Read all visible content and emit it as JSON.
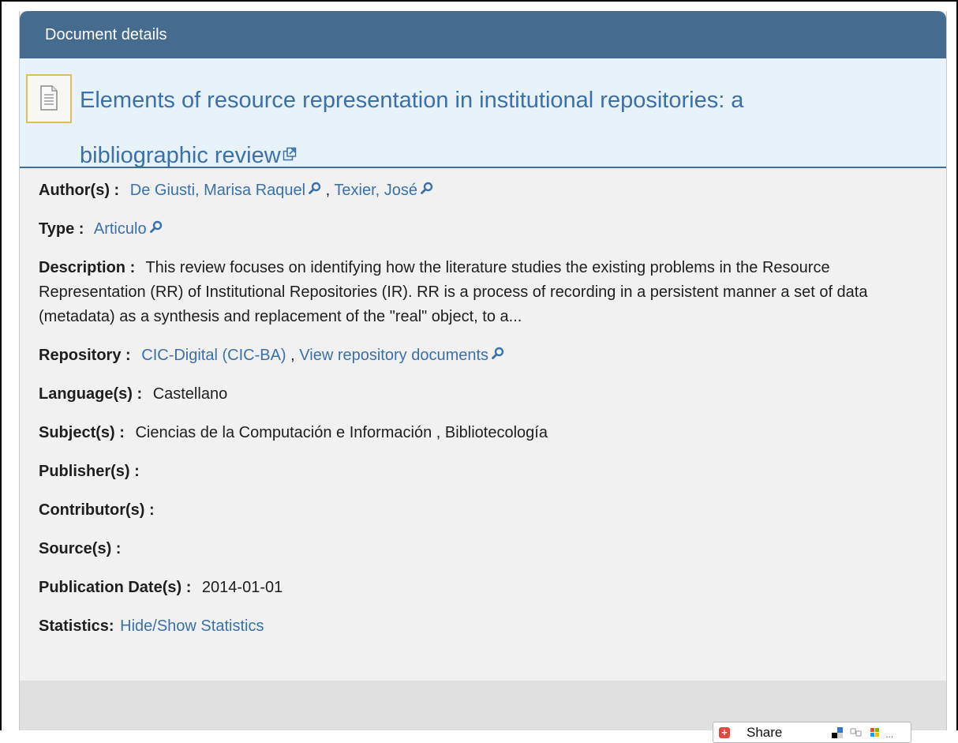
{
  "panel": {
    "header_title": "Document details"
  },
  "document": {
    "title_line1": "Elements of resource representation in institutional repositories: a",
    "title_line2": "bibliographic review"
  },
  "fields": {
    "authors": {
      "label": "Author(s) :",
      "values": [
        "De Giusti, Marisa Raquel",
        "Texier, José"
      ],
      "separator": ","
    },
    "type": {
      "label": "Type :",
      "value": "Articulo"
    },
    "description": {
      "label": "Description :",
      "value": "This review focuses on identifying how the literature studies the existing problems in the Resource Representation (RR) of Institutional Repositories (IR). RR is a process of recording in a persistent manner a set of data (metadata) as a synthesis and replacement of the \"real\" object, to a..."
    },
    "repository": {
      "label": "Repository :",
      "value": "CIC-Digital (CIC-BA)",
      "separator": ",",
      "view_link": "View repository documents"
    },
    "languages": {
      "label": "Language(s) :",
      "value": "Castellano"
    },
    "subjects": {
      "label": "Subject(s) :",
      "value": "Ciencias de la Computación e Información , Bibliotecología"
    },
    "publishers": {
      "label": "Publisher(s) :"
    },
    "contributors": {
      "label": "Contributor(s) :"
    },
    "sources": {
      "label": "Source(s) :"
    },
    "publication_date": {
      "label": "Publication Date(s) :",
      "value": "2014-01-01"
    },
    "statistics": {
      "label": "Statistics:",
      "link": "Hide/Show Statistics"
    }
  },
  "share": {
    "label": "Share",
    "icon_names": [
      "plus-icon",
      "delicious-icon",
      "digg-icon",
      "ms-icon"
    ],
    "ellipsis": "..."
  },
  "colors": {
    "header_bg": "#456b8e",
    "link": "#3b70aa",
    "title_bg": "#e8f2fb",
    "panel_bg": "#f1f1f1"
  }
}
